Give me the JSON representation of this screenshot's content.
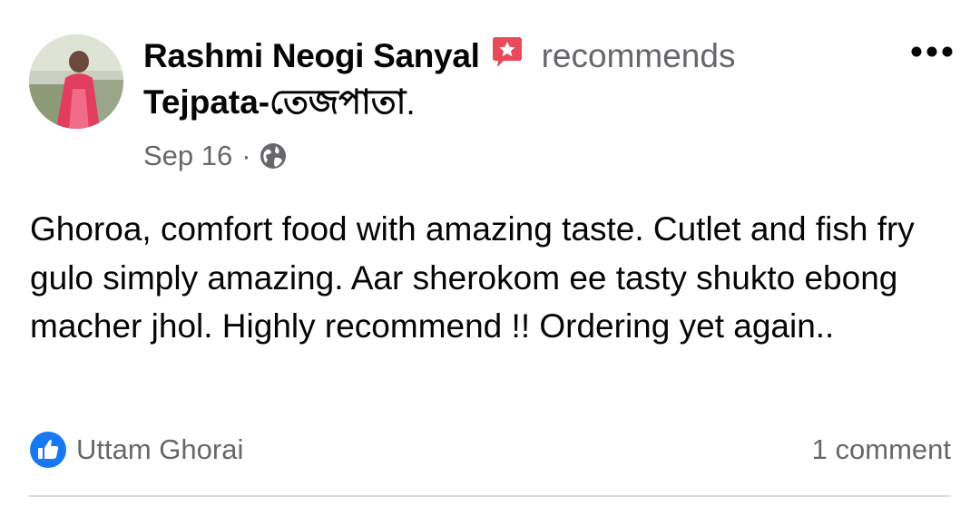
{
  "post": {
    "author": "Rashmi Neogi Sanyal",
    "action": "recommends",
    "page": "Tejpata-তেজপাতা",
    "page_suffix": ".",
    "date": "Sep 16",
    "separator": "·",
    "privacy_icon": "globe-icon",
    "recommend_icon": "recommendation-badge-icon",
    "more_icon": "more-options-icon",
    "text": "Ghoroa, comfort food with amazing taste. Cutlet and fish fry gulo simply amazing. Aar sherokom ee tasty shukto ebong macher jhol. Highly recommend !! Ordering yet again.."
  },
  "footer": {
    "reaction_icon": "like-icon",
    "reactor": "Uttam Ghorai",
    "comments": "1 comment"
  },
  "colors": {
    "primary_text": "#050505",
    "secondary_text": "#65676b",
    "recommend_badge": "#e8495b",
    "like_blue": "#1877f2",
    "divider": "#dadde1"
  }
}
